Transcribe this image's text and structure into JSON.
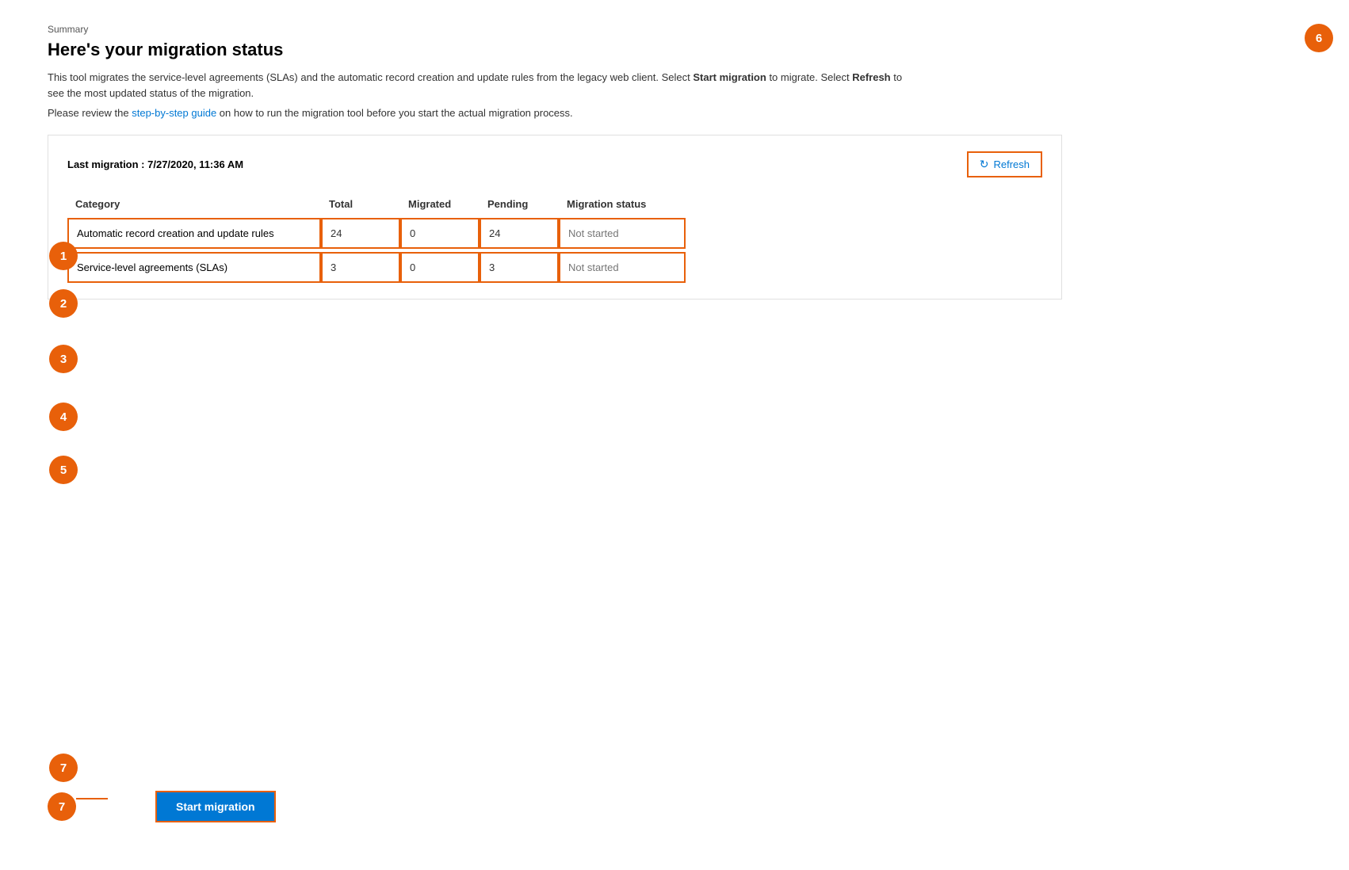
{
  "page": {
    "breadcrumb": "Summary",
    "title": "Here's your migration status",
    "description": "This tool migrates the service-level agreements (SLAs) and the automatic record creation and update rules from the legacy web client. Select ",
    "description_bold1": "Start migration",
    "description_mid": " to migrate. Select ",
    "description_bold2": "Refresh",
    "description_end": " to see the most updated status of the migration.",
    "guide_prefix": "Please review the ",
    "guide_link_text": "step-by-step guide",
    "guide_suffix": " on how to run the migration tool before you start the actual migration process.",
    "last_migration_label": "Last migration : 7/27/2020, 11:36 AM",
    "refresh_label": "Refresh",
    "start_migration_label": "Start migration"
  },
  "table": {
    "headers": {
      "category": "Category",
      "total": "Total",
      "migrated": "Migrated",
      "pending": "Pending",
      "migration_status": "Migration status"
    },
    "rows": [
      {
        "category": "Automatic record creation and update rules",
        "total": "24",
        "migrated": "0",
        "pending": "24",
        "status": "Not started"
      },
      {
        "category": "Service-level agreements (SLAs)",
        "total": "3",
        "migrated": "0",
        "pending": "3",
        "status": "Not started"
      }
    ]
  },
  "annotations": [
    {
      "number": "1",
      "desc": "category-annotation"
    },
    {
      "number": "2",
      "desc": "total-annotation"
    },
    {
      "number": "3",
      "desc": "migrated-annotation"
    },
    {
      "number": "4",
      "desc": "pending-annotation"
    },
    {
      "number": "5",
      "desc": "status-annotation"
    },
    {
      "number": "6",
      "desc": "refresh-annotation"
    },
    {
      "number": "7",
      "desc": "start-migration-annotation"
    }
  ]
}
